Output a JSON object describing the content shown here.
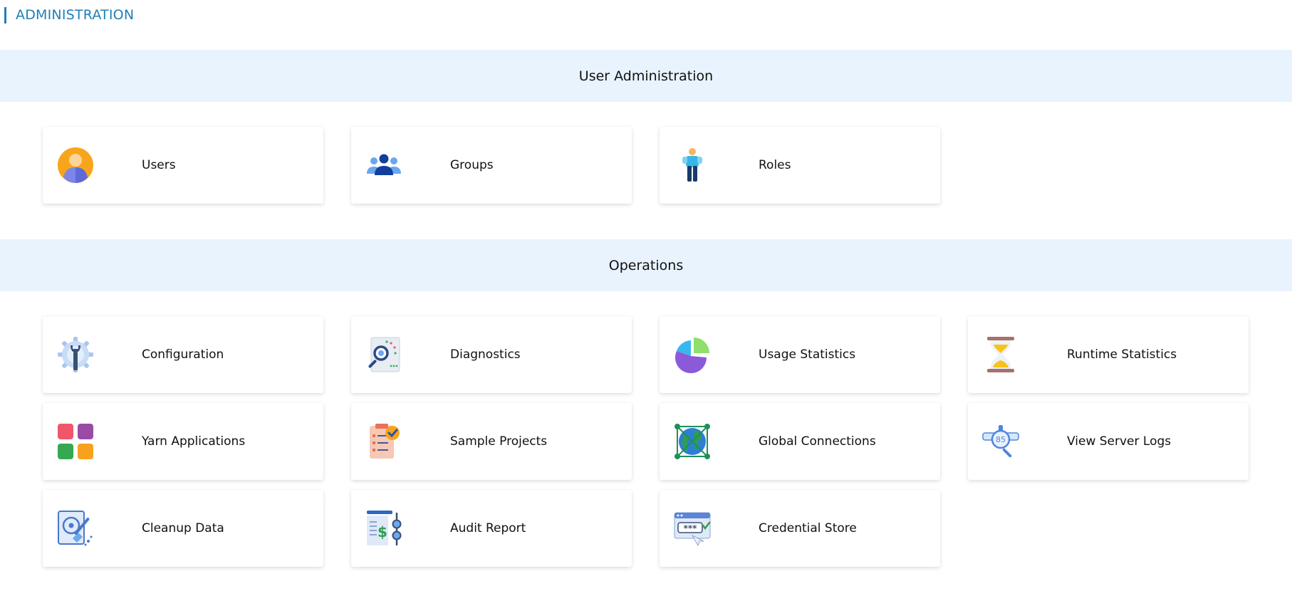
{
  "page": {
    "title": "ADMINISTRATION"
  },
  "sections": [
    {
      "title": "User Administration",
      "cards": [
        {
          "label": "Users",
          "icon": "user-icon"
        },
        {
          "label": "Groups",
          "icon": "groups-icon"
        },
        {
          "label": "Roles",
          "icon": "role-icon"
        }
      ]
    },
    {
      "title": "Operations",
      "cards": [
        {
          "label": "Configuration",
          "icon": "gear-wrench-icon"
        },
        {
          "label": "Diagnostics",
          "icon": "diagnostics-icon"
        },
        {
          "label": "Usage Statistics",
          "icon": "pie-chart-icon"
        },
        {
          "label": "Runtime Statistics",
          "icon": "hourglass-icon"
        },
        {
          "label": "Yarn Applications",
          "icon": "apps-grid-icon"
        },
        {
          "label": "Sample Projects",
          "icon": "clipboard-check-icon"
        },
        {
          "label": "Global Connections",
          "icon": "globe-network-icon"
        },
        {
          "label": "View Server Logs",
          "icon": "log-search-icon"
        },
        {
          "label": "Cleanup Data",
          "icon": "disk-cleanup-icon"
        },
        {
          "label": "Audit Report",
          "icon": "audit-report-icon"
        },
        {
          "label": "Credential Store",
          "icon": "credential-icon"
        }
      ]
    }
  ],
  "colors": {
    "accent": "#1f80b8",
    "section_header_bg": "#e8f3fe"
  }
}
